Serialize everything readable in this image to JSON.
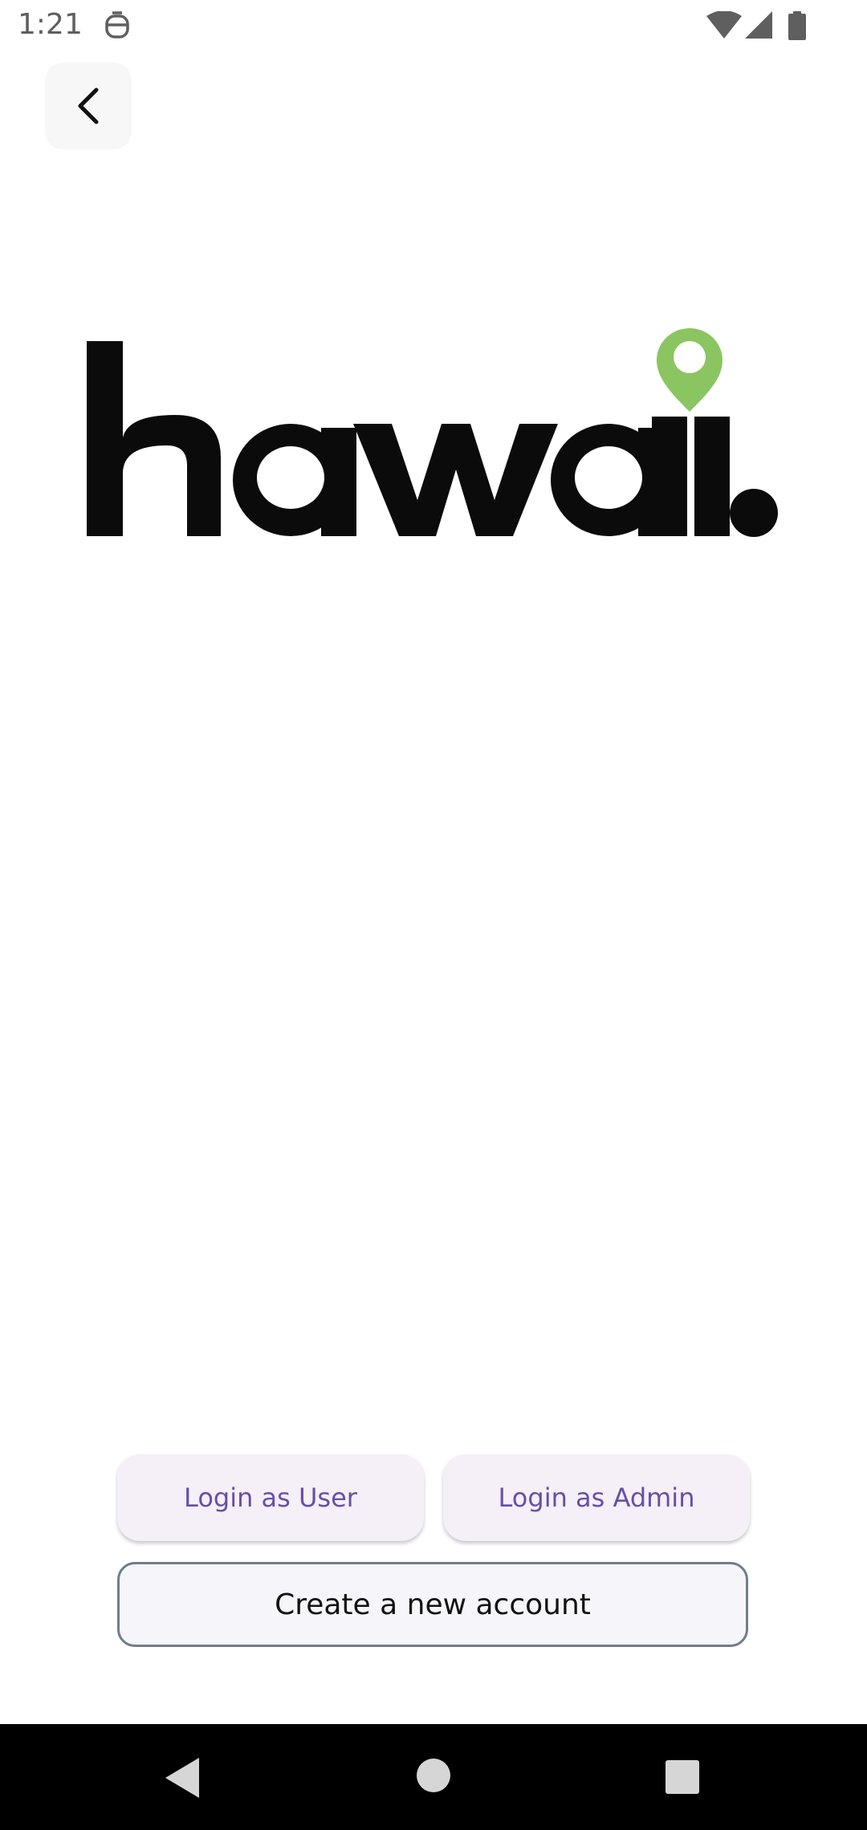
{
  "status_bar": {
    "time": "1:21",
    "icons": [
      "app-notification-icon",
      "wifi-icon",
      "cellular-signal-icon",
      "battery-icon"
    ]
  },
  "header": {
    "back_icon": "chevron-left-icon"
  },
  "logo": {
    "text": "hawaii.",
    "pin_color": "#8bc561",
    "text_color": "#0b0b0c"
  },
  "actions": {
    "login_user_label": "Login as User",
    "login_admin_label": "Login as Admin",
    "create_account_label": "Create a new account"
  },
  "colors": {
    "accent": "#6750a4",
    "tonal_button_bg": "#f5eff7",
    "outline": "#6d7f8b"
  },
  "nav_bar": {
    "icons": [
      "nav-back-icon",
      "nav-home-icon",
      "nav-recents-icon"
    ]
  }
}
